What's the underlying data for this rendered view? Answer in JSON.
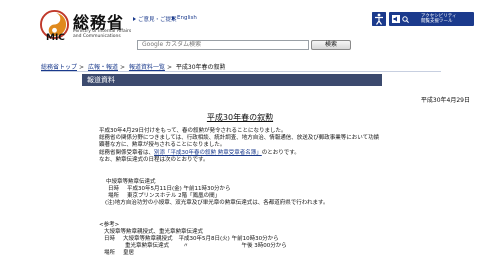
{
  "header": {
    "logo_kanji": "総務省",
    "logo_abbr": "MIC",
    "logo_en_line1": "Ministry of Internal Affairs",
    "logo_en_line2": "and Communications",
    "links": [
      {
        "label": "ご意見・ご提案"
      },
      {
        "label": "English"
      }
    ],
    "search_placeholder": "Google カスタム検索",
    "search_button": "検索",
    "toolbar_label_line1": "アクセシビリティ",
    "toolbar_label_line2": "閲覧支援ツール"
  },
  "breadcrumb": [
    {
      "label": "総務省トップ",
      "link": true
    },
    {
      "label": "広報・報道",
      "link": true
    },
    {
      "label": "報道資料一覧",
      "link": true
    },
    {
      "label": "平成30年春の叙勲",
      "link": false
    }
  ],
  "section_title": "報道資料",
  "date": "平成30年4月29日",
  "title": "平成30年春の叙勲",
  "paragraphs": [
    "平成30年4月29日付けをもって、春の叙勲が発令されることになりました。",
    "総務省の関係分野につきましては、行政相談、統計調査、地方自治、情報通信、放送及び郵政事業等において功績",
    "顕著な方に、勲章が授与されることになりました。"
  ],
  "link_line": {
    "prefix": "総務省関係受章者は、",
    "link": "別添「平成30年春の叙勲 勲章受章者名簿」",
    "suffix": "のとおりです。"
  },
  "note_line": "なお、勲章伝達式の日程は次のとおりです。",
  "ceremony": {
    "heading": "中綬章等勲章伝達式",
    "date_label": "日時",
    "date_value": "平成30年5月11日(金) 午前11時30分から",
    "place_label": "場所",
    "place_value": "東京プリンスホテル 2階「鳳凰の間」",
    "note": "(注)地方自治功労の小綬章、双光章及び単光章の勲章伝達式は、各都道府県で行われます。"
  },
  "reference": {
    "heading": "<参考>",
    "line1": "大綬章等勲章親授式、重光章勲章伝達式",
    "line2_label": "日時",
    "line2_event": "大綬章等勲章親授式",
    "line2_value": "平成30年5月8日(火) 午前10時30分から",
    "line3_event": "重光章勲章伝達式",
    "line3_mark": "〃",
    "line3_value": "午後 3時00分から",
    "line4_label": "場所",
    "line4_value": "皇居"
  }
}
